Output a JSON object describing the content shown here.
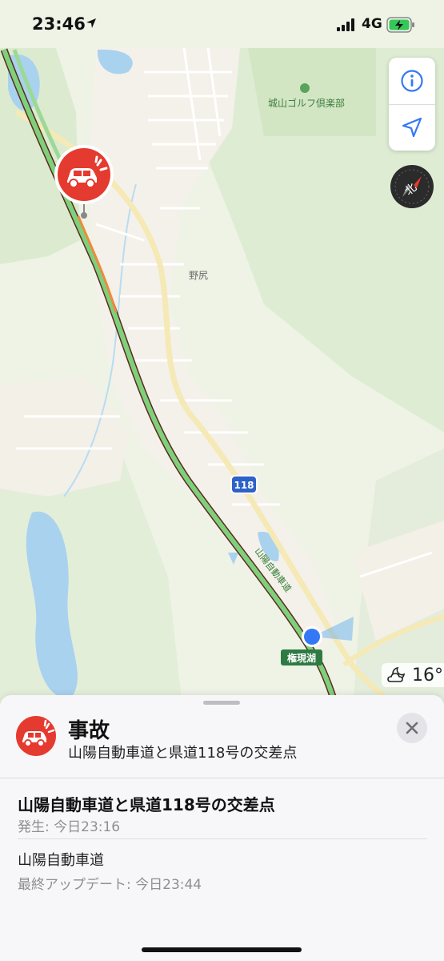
{
  "status_bar": {
    "time": "23:46",
    "network": "4G"
  },
  "map": {
    "labels": {
      "golf": "城山ゴルフ倶楽部",
      "town": "野尻",
      "route": "118",
      "lake": "権現湖",
      "expressway": "山陽自動車道"
    },
    "compass_label": "北",
    "weather": {
      "icon": "partly-cloudy-night-icon",
      "temperature": "16°"
    }
  },
  "sheet": {
    "title": "事故",
    "subtitle": "山陽自動車道と県道118号の交差点",
    "detail_title": "山陽自動車道と県道118号の交差点",
    "occurred": "発生: 今日23:16",
    "road": "山陽自動車道",
    "last_update": "最終アップデート: 今日23:44"
  },
  "colors": {
    "accent": "#3478f6",
    "incident": "#e53a2f",
    "traffic_green": "#7fd07a",
    "road_casing": "#5a2b22"
  }
}
